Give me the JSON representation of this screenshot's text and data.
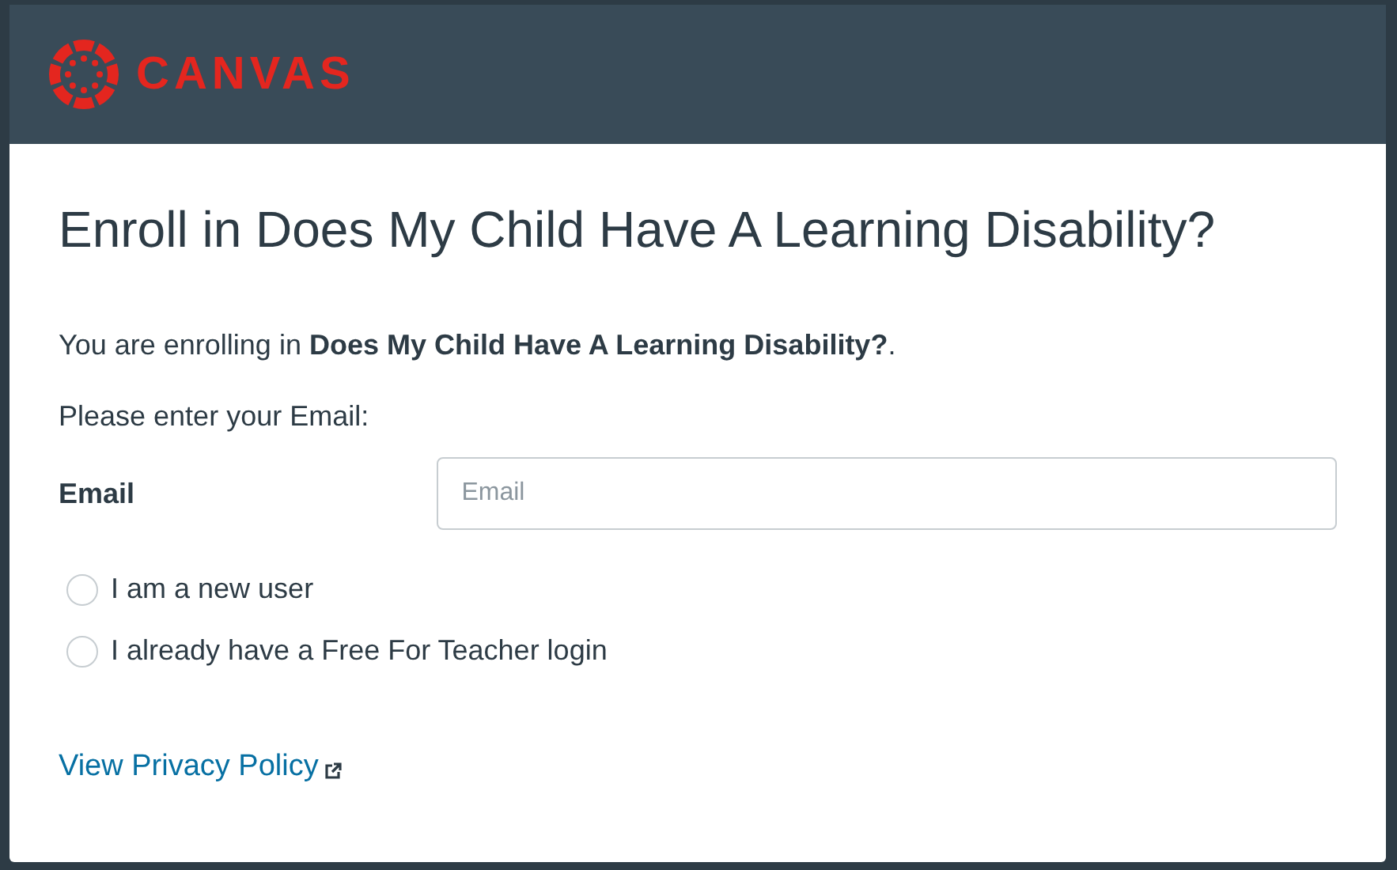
{
  "header": {
    "logo_text": "CANVAS"
  },
  "title": "Enroll in Does My Child Have A Learning Disability?",
  "intro": "You are enrolling in **Does My Child Have A Learning Disability?**.",
  "prompt": "Please enter your Email:",
  "email": {
    "label": "Email",
    "placeholder": "Email"
  },
  "options": [
    {
      "label": "I am a new user",
      "selected": false
    },
    {
      "label": "I already have a Free For Teacher login",
      "selected": false
    }
  ],
  "privacy_link": "View Privacy Policy"
}
